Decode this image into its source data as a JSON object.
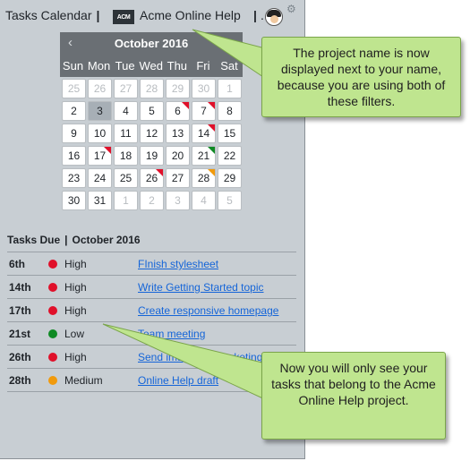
{
  "header": {
    "calendar_label": "Tasks Calendar",
    "separator": "|",
    "logo_text": "ACM",
    "project_name": "Acme Online Help",
    "more": "."
  },
  "calendar": {
    "month_title": "October 2016",
    "prev_label": "‹",
    "next_label": "›",
    "weekdays": [
      "Sun",
      "Mon",
      "Tue",
      "Wed",
      "Thu",
      "Fri",
      "Sat"
    ],
    "days": [
      {
        "label": "25",
        "muted": true,
        "flag": null,
        "today": false
      },
      {
        "label": "26",
        "muted": true,
        "flag": null,
        "today": false
      },
      {
        "label": "27",
        "muted": true,
        "flag": null,
        "today": false
      },
      {
        "label": "28",
        "muted": true,
        "flag": null,
        "today": false
      },
      {
        "label": "29",
        "muted": true,
        "flag": null,
        "today": false
      },
      {
        "label": "30",
        "muted": true,
        "flag": null,
        "today": false
      },
      {
        "label": "1",
        "muted": true,
        "flag": null,
        "today": false
      },
      {
        "label": "2",
        "muted": false,
        "flag": null,
        "today": false
      },
      {
        "label": "3",
        "muted": false,
        "flag": null,
        "today": true
      },
      {
        "label": "4",
        "muted": false,
        "flag": null,
        "today": false
      },
      {
        "label": "5",
        "muted": false,
        "flag": null,
        "today": false
      },
      {
        "label": "6",
        "muted": false,
        "flag": "red",
        "today": false
      },
      {
        "label": "7",
        "muted": false,
        "flag": "red",
        "today": false
      },
      {
        "label": "8",
        "muted": false,
        "flag": null,
        "today": false
      },
      {
        "label": "9",
        "muted": false,
        "flag": null,
        "today": false
      },
      {
        "label": "10",
        "muted": false,
        "flag": null,
        "today": false
      },
      {
        "label": "11",
        "muted": false,
        "flag": null,
        "today": false
      },
      {
        "label": "12",
        "muted": false,
        "flag": null,
        "today": false
      },
      {
        "label": "13",
        "muted": false,
        "flag": null,
        "today": false
      },
      {
        "label": "14",
        "muted": false,
        "flag": "red",
        "today": false
      },
      {
        "label": "15",
        "muted": false,
        "flag": null,
        "today": false
      },
      {
        "label": "16",
        "muted": false,
        "flag": null,
        "today": false
      },
      {
        "label": "17",
        "muted": false,
        "flag": "red",
        "today": false
      },
      {
        "label": "18",
        "muted": false,
        "flag": null,
        "today": false
      },
      {
        "label": "19",
        "muted": false,
        "flag": null,
        "today": false
      },
      {
        "label": "20",
        "muted": false,
        "flag": null,
        "today": false
      },
      {
        "label": "21",
        "muted": false,
        "flag": "green",
        "today": false
      },
      {
        "label": "22",
        "muted": false,
        "flag": null,
        "today": false
      },
      {
        "label": "23",
        "muted": false,
        "flag": null,
        "today": false
      },
      {
        "label": "24",
        "muted": false,
        "flag": null,
        "today": false
      },
      {
        "label": "25",
        "muted": false,
        "flag": null,
        "today": false
      },
      {
        "label": "26",
        "muted": false,
        "flag": "red",
        "today": false
      },
      {
        "label": "27",
        "muted": false,
        "flag": null,
        "today": false
      },
      {
        "label": "28",
        "muted": false,
        "flag": "orange",
        "today": false
      },
      {
        "label": "29",
        "muted": false,
        "flag": null,
        "today": false
      },
      {
        "label": "30",
        "muted": false,
        "flag": null,
        "today": false
      },
      {
        "label": "31",
        "muted": false,
        "flag": null,
        "today": false
      },
      {
        "label": "1",
        "muted": true,
        "flag": null,
        "today": false
      },
      {
        "label": "2",
        "muted": true,
        "flag": null,
        "today": false
      },
      {
        "label": "3",
        "muted": true,
        "flag": null,
        "today": false
      },
      {
        "label": "4",
        "muted": true,
        "flag": null,
        "today": false
      },
      {
        "label": "5",
        "muted": true,
        "flag": null,
        "today": false
      }
    ]
  },
  "tasks": {
    "label": "Tasks Due",
    "month": "October 2016",
    "rows": [
      {
        "date": "6th",
        "priority": "High",
        "color": "#e0102a",
        "task": "FInish stylesheet "
      },
      {
        "date": "14th",
        "priority": "High",
        "color": "#e0102a",
        "task": "Write Getting Started topic "
      },
      {
        "date": "17th",
        "priority": "High",
        "color": "#e0102a",
        "task": "Create responsive homepage"
      },
      {
        "date": "21st",
        "priority": "Low",
        "color": "#0f8a24",
        "task": "Team meeting "
      },
      {
        "date": "26th",
        "priority": "High",
        "color": "#e0102a",
        "task": "Send images to marketing"
      },
      {
        "date": "28th",
        "priority": "Medium",
        "color": "#f19a0c",
        "task": "Online Help draft"
      }
    ]
  },
  "callouts": {
    "top": "The project name is now displayed next to your name, because you are using both of these filters.",
    "bottom": "Now you will only see your tasks that belong to the Acme Online Help project."
  },
  "icons": {
    "settings": "gear-icon",
    "avatar": "user-avatar",
    "logo": "acme-logo-icon"
  }
}
